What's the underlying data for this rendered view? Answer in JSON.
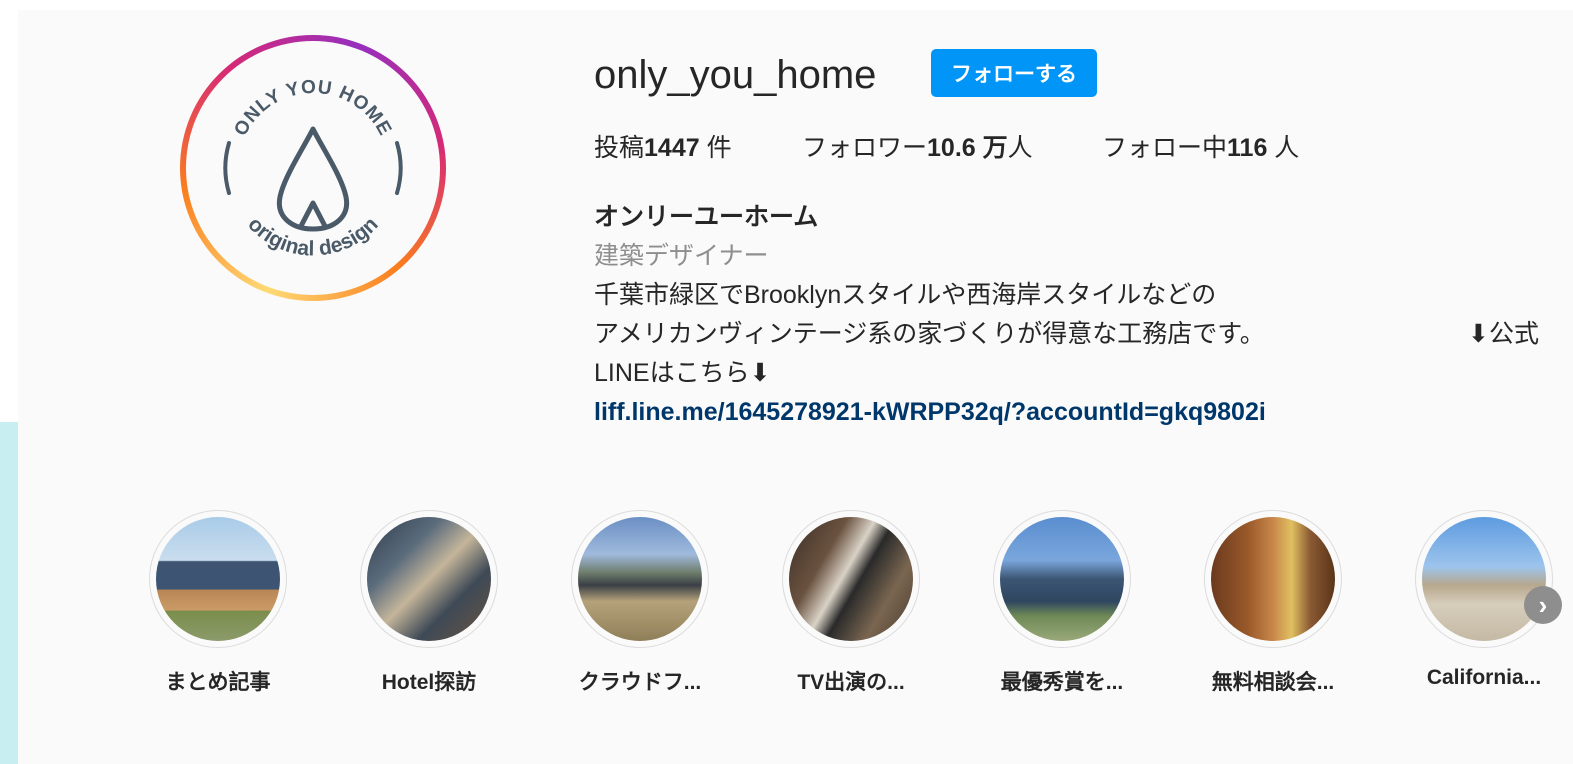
{
  "profile": {
    "username": "only_you_home",
    "follow_label": "フォローする",
    "avatar": {
      "top_text": "ONLY YOU HOME",
      "bottom_text": "original design"
    }
  },
  "stats": {
    "posts_label": "投稿",
    "posts_value": "1447",
    "posts_unit": " 件",
    "followers_label": "フォロワー",
    "followers_value": "10.6 万",
    "followers_unit": "人",
    "following_label": "フォロー中",
    "following_value": "116",
    "following_unit": " 人"
  },
  "bio": {
    "name": "オンリーユーホーム",
    "category": "建築デザイナー",
    "line1": "千葉市緑区でBrooklynスタイルや西海岸スタイルなどの",
    "line2": "アメリカンヴィンテージ系の家づくりが得意な工務店です。",
    "line2_right": "⬇公式",
    "line3": "LINEはこちら⬇",
    "link": "liff.line.me/1645278921-kWRPP32q/?accountId=gkq9802i"
  },
  "highlights": [
    {
      "label": "まとめ記事"
    },
    {
      "label": "Hotel探訪"
    },
    {
      "label": "クラウドフ..."
    },
    {
      "label": "TV出演の..."
    },
    {
      "label": "最優秀賞を..."
    },
    {
      "label": "無料相談会..."
    },
    {
      "label": "California..."
    }
  ],
  "colors": {
    "follow_button": "#0095f6",
    "link": "#00376b",
    "category": "#8e8e8e",
    "logo_gray": "#4a5a68"
  }
}
